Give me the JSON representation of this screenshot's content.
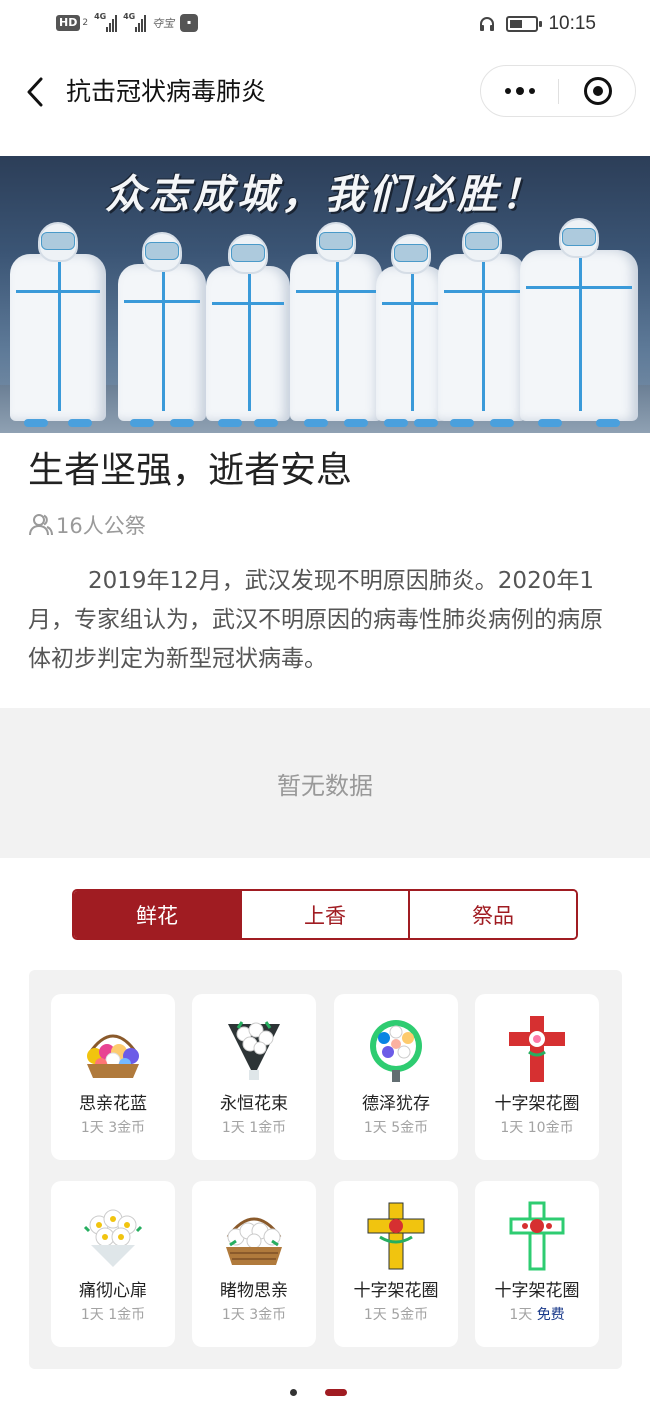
{
  "status_bar": {
    "hd": "HD",
    "hd_sub": "2",
    "sim1": "4G",
    "sim2": "4G",
    "app_text": "夺宝",
    "time": "10:15"
  },
  "nav": {
    "title": "抗击冠状病毒肺炎"
  },
  "banner": {
    "slogan": "众志成城，我们必胜！"
  },
  "memorial": {
    "title": "生者坚强，逝者安息",
    "mourners": "16人公祭",
    "description": "2019年12月，武汉发现不明原因肺炎。2020年1月，专家组认为，武汉不明原因的病毒性肺炎病例的病原体初步判定为新型冠状病毒。"
  },
  "empty_state": {
    "text": "暂无数据"
  },
  "tabs": [
    {
      "label": "鲜花",
      "active": true
    },
    {
      "label": "上香",
      "active": false
    },
    {
      "label": "祭品",
      "active": false
    }
  ],
  "items": [
    {
      "name": "思亲花蓝",
      "duration": "1天",
      "cost": "3金币",
      "icon": "flower-basket-icon"
    },
    {
      "name": "永恒花束",
      "duration": "1天",
      "cost": "1金币",
      "icon": "bouquet-icon"
    },
    {
      "name": "德泽犹存",
      "duration": "1天",
      "cost": "5金币",
      "icon": "wreath-icon"
    },
    {
      "name": "十字架花圈",
      "duration": "1天",
      "cost": "10金币",
      "icon": "red-cross-wreath-icon"
    },
    {
      "name": "痛彻心扉",
      "duration": "1天",
      "cost": "1金币",
      "icon": "white-bouquet-icon"
    },
    {
      "name": "睹物思亲",
      "duration": "1天",
      "cost": "3金币",
      "icon": "white-basket-icon"
    },
    {
      "name": "十字架花圈",
      "duration": "1天",
      "cost": "5金币",
      "icon": "yellow-cross-wreath-icon"
    },
    {
      "name": "十字架花圈",
      "duration": "1天",
      "cost": "免费",
      "icon": "white-cross-wreath-icon"
    }
  ],
  "pagination": {
    "pages": 2,
    "current": 2
  },
  "colors": {
    "accent": "#a01c22",
    "free": "#1a3a8a",
    "panel_bg": "#f2f2f2"
  }
}
